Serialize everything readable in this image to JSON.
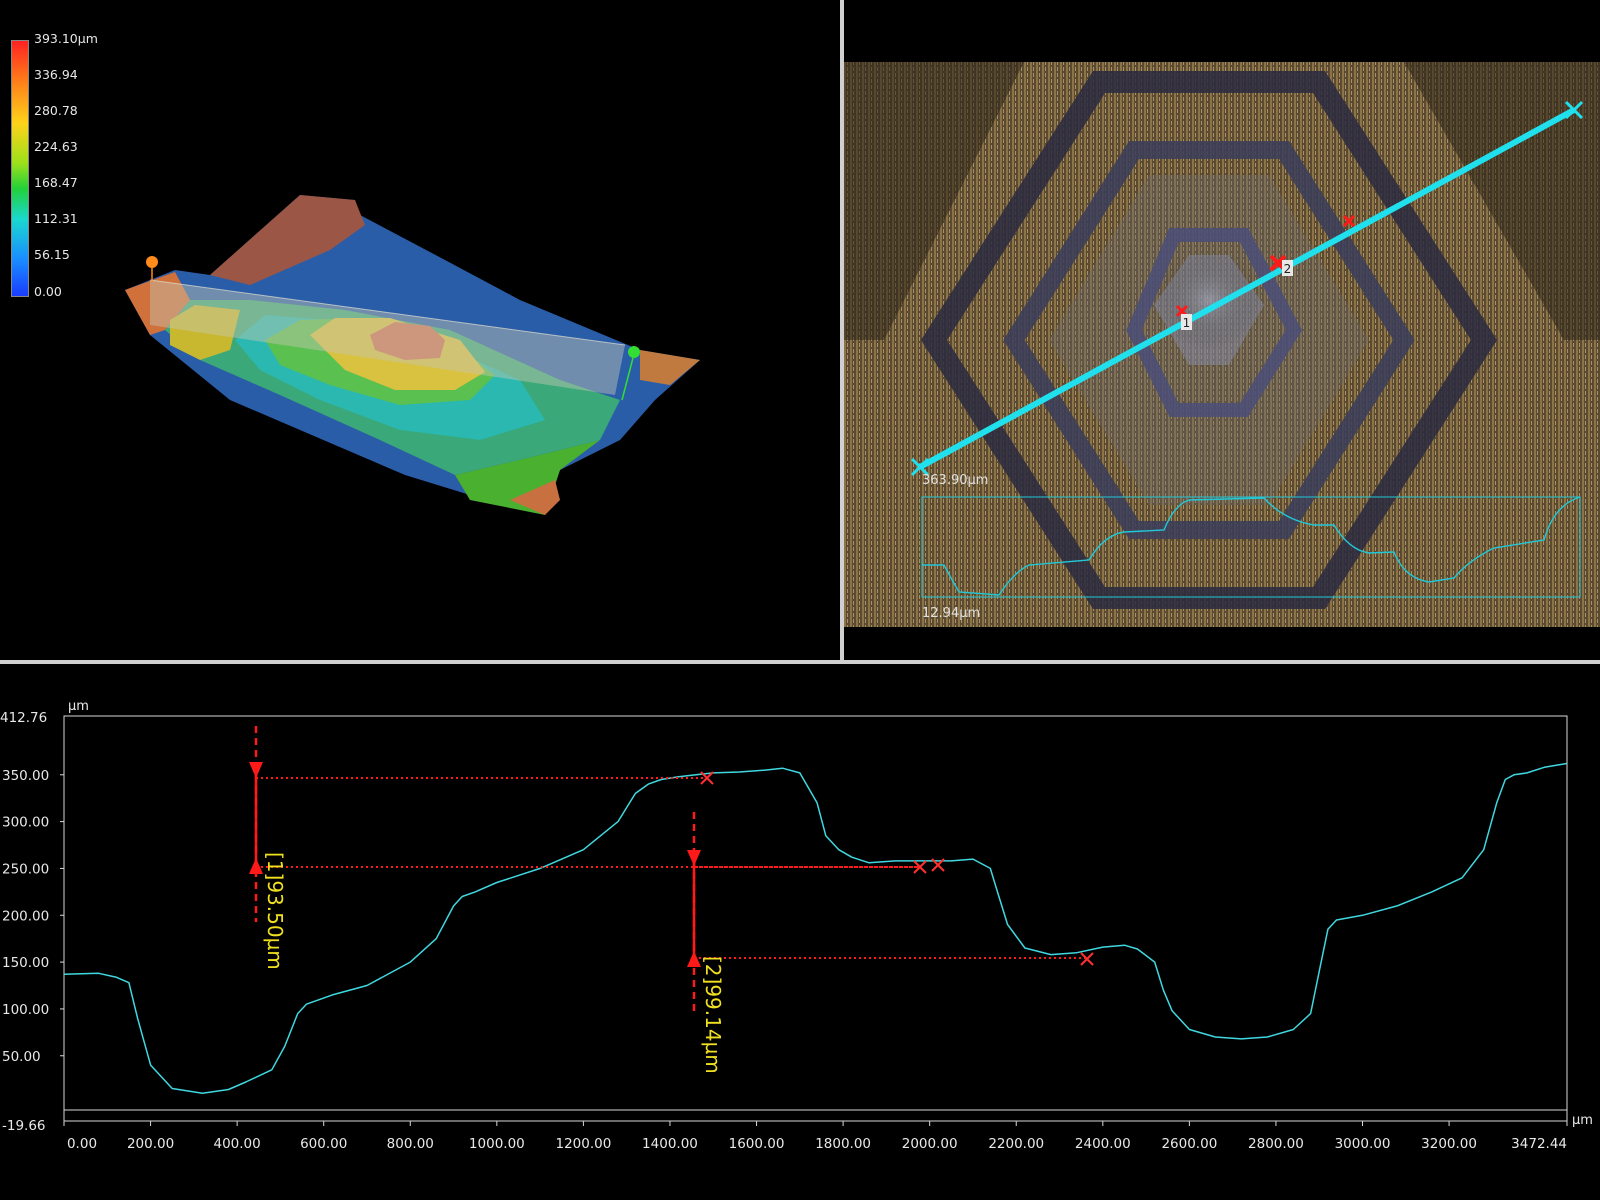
{
  "colors": {
    "profile_line": "#40d8e0",
    "measure_red": "#ff1a1a",
    "measure_text": "#f0e020",
    "line_cyan": "#20e0ee",
    "axis_white": "#e8e8e8"
  },
  "height_scale": {
    "labels": [
      "393.10µm",
      "336.94",
      "280.78",
      "224.63",
      "168.47",
      "112.31",
      "56.15",
      "0.00"
    ]
  },
  "image_view": {
    "line_length_label": "363.90µm",
    "profile_range_label": "12.94µm",
    "point_labels": [
      "1",
      "2"
    ]
  },
  "profile": {
    "y_unit": "µm",
    "x_unit": "µm",
    "y_min_label": "-19.66",
    "y_max_label": "412.76",
    "y_tick_labels": [
      "350.00",
      "300.00",
      "250.00",
      "200.00",
      "150.00",
      "100.00",
      "50.00"
    ],
    "x_tick_labels": [
      "0.00",
      "200.00",
      "400.00",
      "600.00",
      "800.00",
      "1000.00",
      "1200.00",
      "1400.00",
      "1600.00",
      "1800.00",
      "2000.00",
      "2200.00",
      "2400.00",
      "2600.00",
      "2800.00",
      "3000.00",
      "3200.00",
      "3472.44"
    ],
    "measurement_1_label": "[1]93.50µm",
    "measurement_2_label": "[2]99.14µm"
  },
  "chart_data": {
    "type": "line",
    "xlabel": "µm",
    "ylabel": "µm",
    "xlim": [
      0,
      3472.44
    ],
    "ylim": [
      -19.66,
      412.76
    ],
    "series": [
      {
        "x": [
          0,
          80,
          120,
          150,
          170,
          200,
          250,
          320,
          380,
          420,
          480,
          510,
          540,
          560,
          620,
          700,
          800,
          860,
          900,
          920,
          950,
          1000,
          1100,
          1200,
          1280,
          1320,
          1350,
          1380,
          1420,
          1460,
          1500,
          1560,
          1620,
          1660,
          1700,
          1740,
          1760,
          1790,
          1820,
          1860,
          1920,
          1980,
          2050,
          2100,
          2140,
          2160,
          2180,
          2220,
          2280,
          2340,
          2400,
          2450,
          2480,
          2520,
          2540,
          2560,
          2600,
          2660,
          2720,
          2780,
          2840,
          2880,
          2900,
          2920,
          2940,
          3000,
          3080,
          3160,
          3230,
          3280,
          3310,
          3330,
          3350,
          3380,
          3420,
          3472
        ],
        "y": [
          137,
          138,
          134,
          128,
          90,
          40,
          15,
          10,
          14,
          22,
          35,
          60,
          95,
          105,
          115,
          125,
          150,
          175,
          210,
          220,
          225,
          235,
          250,
          270,
          300,
          330,
          340,
          345,
          348,
          350,
          352,
          353,
          355,
          357,
          352,
          320,
          285,
          270,
          262,
          256,
          258,
          258,
          258,
          260,
          250,
          220,
          190,
          165,
          158,
          160,
          166,
          168,
          164,
          150,
          120,
          98,
          78,
          70,
          68,
          70,
          78,
          95,
          140,
          185,
          195,
          200,
          210,
          225,
          240,
          270,
          320,
          345,
          350,
          352,
          358,
          362
        ]
      }
    ]
  }
}
